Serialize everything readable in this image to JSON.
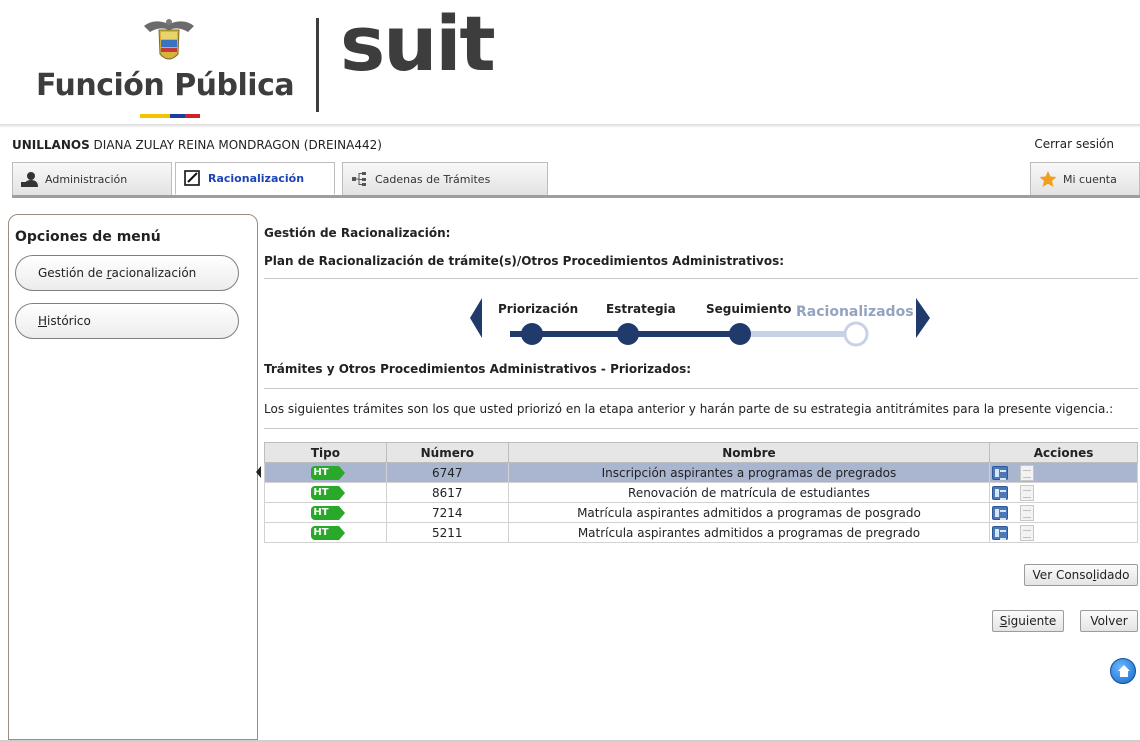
{
  "brand": {
    "org_name": "Función Pública",
    "product_name": "suit"
  },
  "user": {
    "entity": "UNILLANOS",
    "name": "DIANA ZULAY REINA MONDRAGON (DREINA442)",
    "logout_label": "Cerrar sesión"
  },
  "tabs": [
    {
      "label": "Administración",
      "icon": "admin-user-icon",
      "active": false
    },
    {
      "label": "Racionalización",
      "icon": "edit-icon",
      "active": true
    },
    {
      "label": "Cadenas de Trámites",
      "icon": "tree-icon",
      "active": false
    }
  ],
  "account_tab": {
    "label": "Mi cuenta",
    "icon": "star-icon"
  },
  "sidebar": {
    "title": "Opciones de menú",
    "items": [
      {
        "label_pre": "Gestión de ",
        "label_ul": "r",
        "label_post": "acionalización"
      },
      {
        "label_pre": "",
        "label_ul": "H",
        "label_post": "istórico"
      }
    ]
  },
  "main": {
    "title": "Gestión de Racionalización:",
    "subtitle": "Plan de Racionalización de trámite(s)/Otros Procedimientos Administrativos:",
    "section_title": "Trámites y Otros Procedimientos Administrativos - Priorizados:",
    "description": "Los siguientes trámites son los que usted priorizó en la etapa anterior y harán parte de su estrategia antitrámites para la presente vigencia.:"
  },
  "stepper": {
    "steps": [
      {
        "label": "Priorización",
        "state": "done"
      },
      {
        "label": "Estrategia",
        "state": "done"
      },
      {
        "label": "Seguimiento",
        "state": "done"
      },
      {
        "label": "Racionalizados",
        "state": "pending"
      }
    ],
    "colors": {
      "done": "#1f3a6b",
      "pending": "#c7d2e6",
      "arrow": "#1f3a6b"
    }
  },
  "table": {
    "headers": {
      "tipo": "Tipo",
      "numero": "Número",
      "nombre": "Nombre",
      "acciones": "Acciones"
    },
    "rows": [
      {
        "tipo": "HT",
        "numero": "6747",
        "nombre": "Inscripción aspirantes a programas de pregrados",
        "selected": true
      },
      {
        "tipo": "HT",
        "numero": "8617",
        "nombre": "Renovación de matrícula de estudiantes",
        "selected": false
      },
      {
        "tipo": "HT",
        "numero": "7214",
        "nombre": "Matrícula aspirantes admitidos a programas de posgrado",
        "selected": false
      },
      {
        "tipo": "HT",
        "numero": "5211",
        "nombre": "Matrícula aspirantes admitidos a programas de pregrado",
        "selected": false
      }
    ]
  },
  "buttons": {
    "consolidado_pre": "Ver Conso",
    "consolidado_ul": "l",
    "consolidado_post": "idado",
    "siguiente_ul": "S",
    "siguiente_post": "iguiente",
    "volver": "Volver"
  },
  "colors": {
    "selected_row": "#aab6d0",
    "badge_green": "#29a829",
    "active_tab_text": "#1a44b8"
  }
}
